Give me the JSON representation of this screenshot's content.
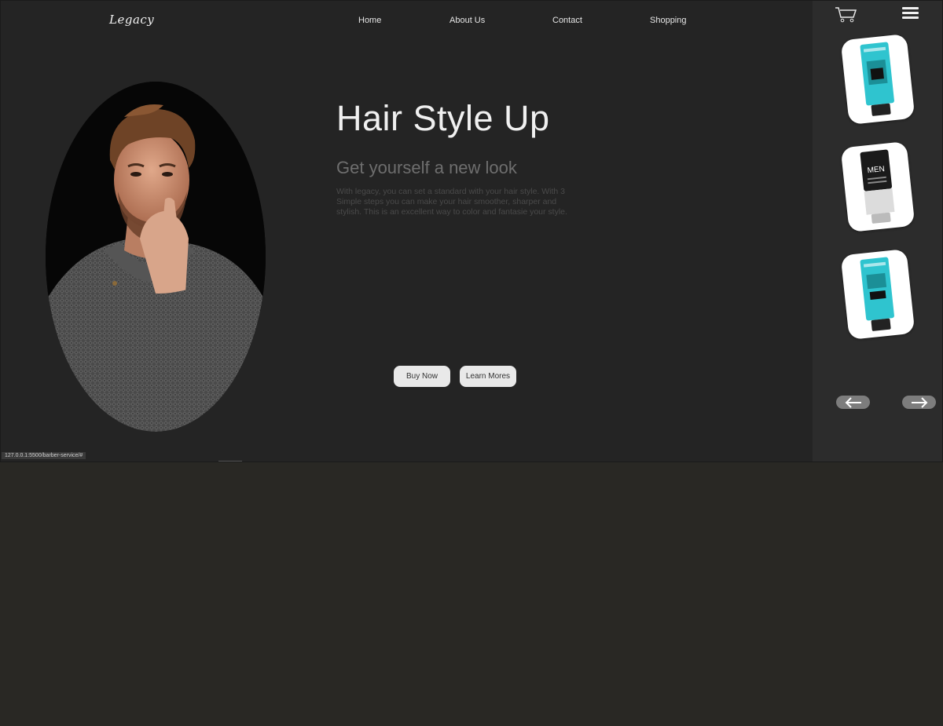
{
  "brand": {
    "logo": "Legacy"
  },
  "nav": {
    "items": [
      {
        "label": "Home"
      },
      {
        "label": "About Us"
      },
      {
        "label": "Contact"
      },
      {
        "label": "Shopping"
      }
    ]
  },
  "hero": {
    "title": "Hair Style Up",
    "subtitle": "Get yourself a new look",
    "description": "With legacy, you can set a standard with your hair style. With 3 Simple steps you can make your hair smoother, sharper and stylish. This is an excellent way to color and fantasie your style.",
    "buy_label": "Buy Now",
    "learn_label": "Learn Mores"
  },
  "sidebar": {
    "products": [
      {
        "name": "teal-hair-gel-tube",
        "tube_color": "#2fc4cf",
        "text": ""
      },
      {
        "name": "men-hair-gel-tube",
        "tube_color": "#1a1a1a",
        "text": "MEN"
      },
      {
        "name": "teal-hair-gel-tube",
        "tube_color": "#2fc4cf",
        "text": ""
      }
    ]
  },
  "status_bar": {
    "url": "127.0.0.1:5500/barber-service/#"
  },
  "colors": {
    "page_bg": "#242424",
    "sidebar_bg": "#2c2c2c",
    "below_fold_bg": "#292824",
    "button_bg": "#e9e9e9",
    "accent_teal": "#2fc4cf"
  }
}
